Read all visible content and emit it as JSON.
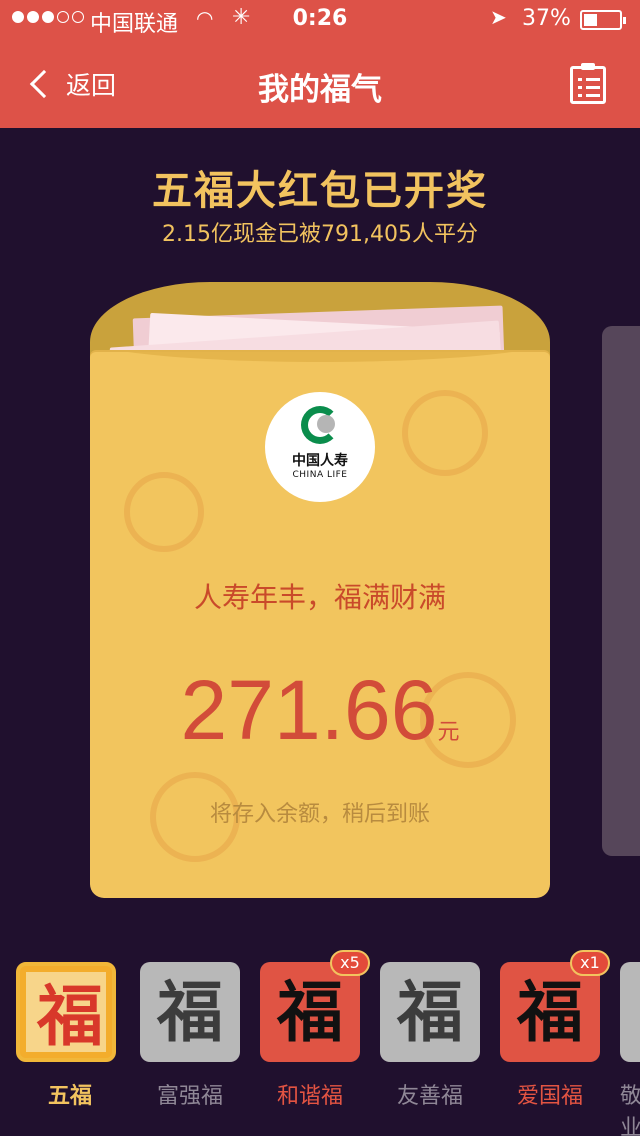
{
  "status_bar": {
    "carrier": "中国联通",
    "time": "0:26",
    "battery": "37%",
    "battery_level": 0.37
  },
  "nav": {
    "back_label": "返回",
    "title": "我的福气"
  },
  "headline": "五福大红包已开奖",
  "subheadline": "2.15亿现金已被791,405人平分",
  "envelope": {
    "brand_cn": "中国人寿",
    "brand_en": "CHINA LIFE",
    "slogan": "人寿年丰，福满财满",
    "amount": "271.66",
    "unit": "元",
    "note": "将存入余额，稍后到账"
  },
  "cards": [
    {
      "label": "五福",
      "glyph": "福",
      "style": "gold",
      "selected": true
    },
    {
      "label": "富强福",
      "glyph": "福",
      "style": "gray"
    },
    {
      "label": "和谐福",
      "glyph": "福",
      "style": "red",
      "badge": "x5"
    },
    {
      "label": "友善福",
      "glyph": "福",
      "style": "gray"
    },
    {
      "label": "爱国福",
      "glyph": "福",
      "style": "red",
      "badge": "x1"
    },
    {
      "label": "敬业福",
      "glyph": "福",
      "style": "gray"
    }
  ],
  "colors": {
    "nav_bg": "#dd5248",
    "page_bg": "#20102e",
    "gold_text": "#f2c35f",
    "amount_red": "#d24c39",
    "china_life_green": "#0a8d4c"
  }
}
